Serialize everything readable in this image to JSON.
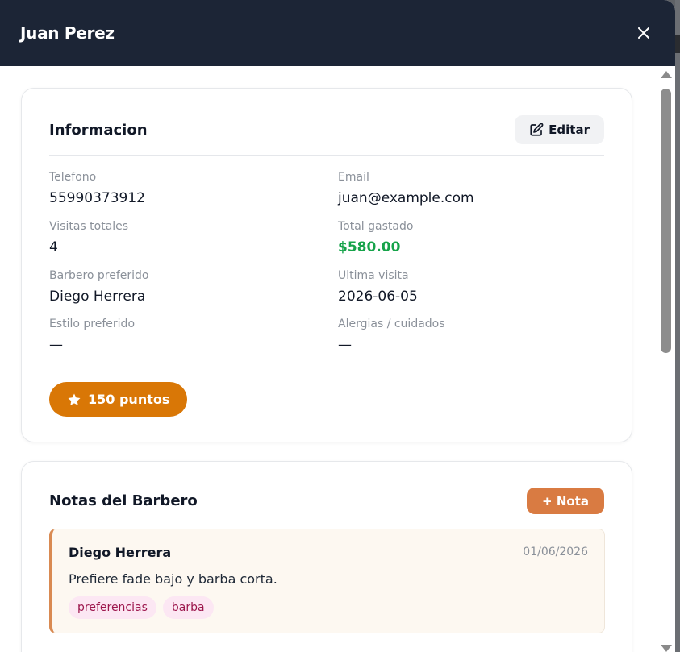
{
  "modal": {
    "title": "Juan Perez"
  },
  "info_card": {
    "title": "Informacion",
    "edit_label": "Editar",
    "fields": [
      {
        "label": "Telefono",
        "value": "55990373912"
      },
      {
        "label": "Email",
        "value": "juan@example.com"
      },
      {
        "label": "Visitas totales",
        "value": "4"
      },
      {
        "label": "Total gastado",
        "value": "$580.00"
      },
      {
        "label": "Barbero preferido",
        "value": "Diego Herrera"
      },
      {
        "label": "Ultima visita",
        "value": "2026-06-05"
      },
      {
        "label": "Estilo preferido",
        "value": "—"
      },
      {
        "label": "Alergias / cuidados",
        "value": "—"
      }
    ],
    "points_label": "150 puntos"
  },
  "notes_card": {
    "title": "Notas del Barbero",
    "add_label": "+ Nota",
    "notes": [
      {
        "author": "Diego Herrera",
        "date": "01/06/2026",
        "text": "Prefiere fade bajo y barba corta.",
        "tags": [
          "preferencias",
          "barba"
        ]
      }
    ]
  },
  "colors": {
    "header_bg": "#1c2536",
    "money": "#16a34a",
    "points_badge": "#d97706",
    "note_button": "#d97b42",
    "note_accent": "#d98a52",
    "tag_bg": "#fce7f3",
    "tag_text": "#9d174d"
  },
  "icons": {
    "close": "close-icon",
    "edit": "edit-icon",
    "points": "star-icon"
  }
}
